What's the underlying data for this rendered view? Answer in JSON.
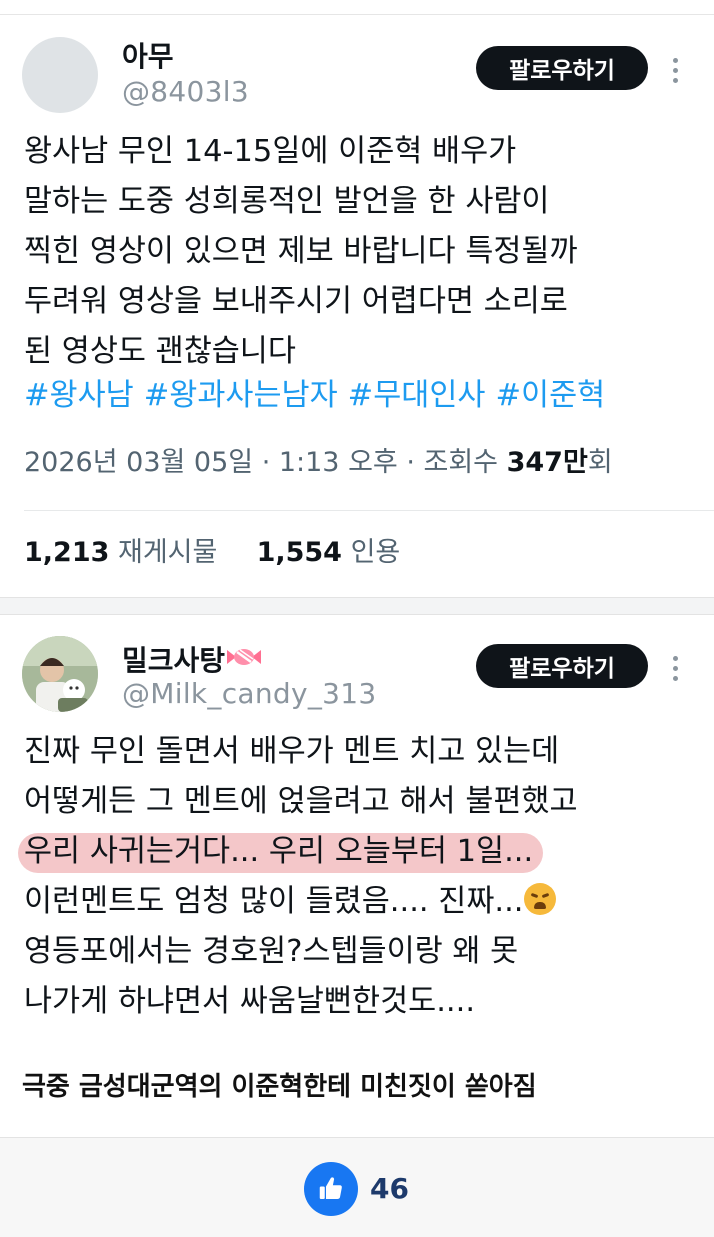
{
  "post1": {
    "author_name": "아무",
    "author_handle": "@8403l3",
    "follow_label": "팔로우하기",
    "text": "왕사남 무인 14-15일에 이준혁 배우가\n말하는 도중 성희롱적인 발언을 한 사람이\n찍힌 영상이 있으면 제보 바랍니다 특정될까\n두려워 영상을 보내주시기 어렵다면 소리로\n된 영상도 괜찮습니다",
    "hashtags": [
      "#왕사남",
      "#왕과사는남자",
      "#무대인사",
      "#이준혁"
    ],
    "date_time": "2026년 03월 05일 · 1:13 오후 · 조회수 ",
    "views_value": "347만",
    "views_suffix": "회",
    "reposts_count": "1,213",
    "reposts_label": "재게시물",
    "quotes_count": "1,554",
    "quotes_label": "인용"
  },
  "post2": {
    "author_name": "밀크사탕",
    "author_handle": "@Milk_candy_313",
    "follow_label": "팔로우하기",
    "line1": "진짜 무인 돌면서 배우가 멘트 치고 있는데",
    "line2": "어떻게든 그 멘트에 얹을려고 해서 불편했고",
    "line3_highlighted": "우리 사귀는거다... 우리 오늘부터 1일...",
    "line4": "이런멘트도 엄청 많이 들렸음.... 진짜...",
    "line5": "영등포에서는 경호원?스텝들이랑 왜 못",
    "line6": "나가게 하냐면서 싸움날뻔한것도...."
  },
  "caption": "극중 금성대군역의 이준혁한테 미친짓이 쏟아짐",
  "reactions": {
    "like_count": "46"
  },
  "colors": {
    "hashtag": "#1d9bf0",
    "highlight": "#f4c7c9",
    "follow_button": "#0f1419",
    "like": "#1877f2"
  },
  "icons": {
    "more": "more-vertical-icon",
    "candy": "candy-emoji-icon",
    "weary": "weary-face-emoji-icon",
    "like": "thumbs-up-icon"
  }
}
